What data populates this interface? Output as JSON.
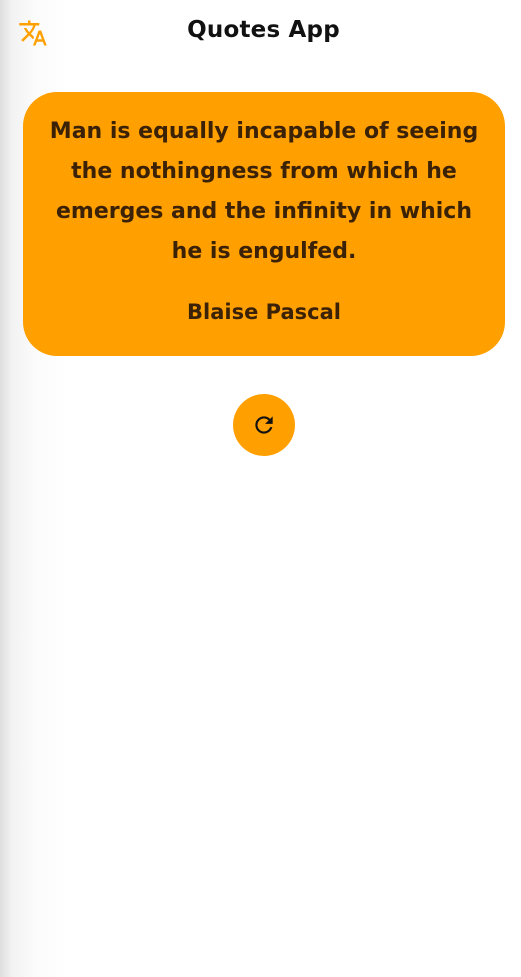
{
  "app_bar": {
    "title": "Quotes App",
    "translate_icon": "translate-icon"
  },
  "quote": {
    "text": "Man is equally incapable of seeing the nothingness from which he emerges and the infinity in which he is engulfed.",
    "author": "Blaise Pascal"
  },
  "actions": {
    "refresh_icon": "refresh-icon"
  },
  "colors": {
    "accent": "#ffa000",
    "card_text": "#3b2106",
    "title_text": "#111111",
    "background": "#ffffff"
  }
}
